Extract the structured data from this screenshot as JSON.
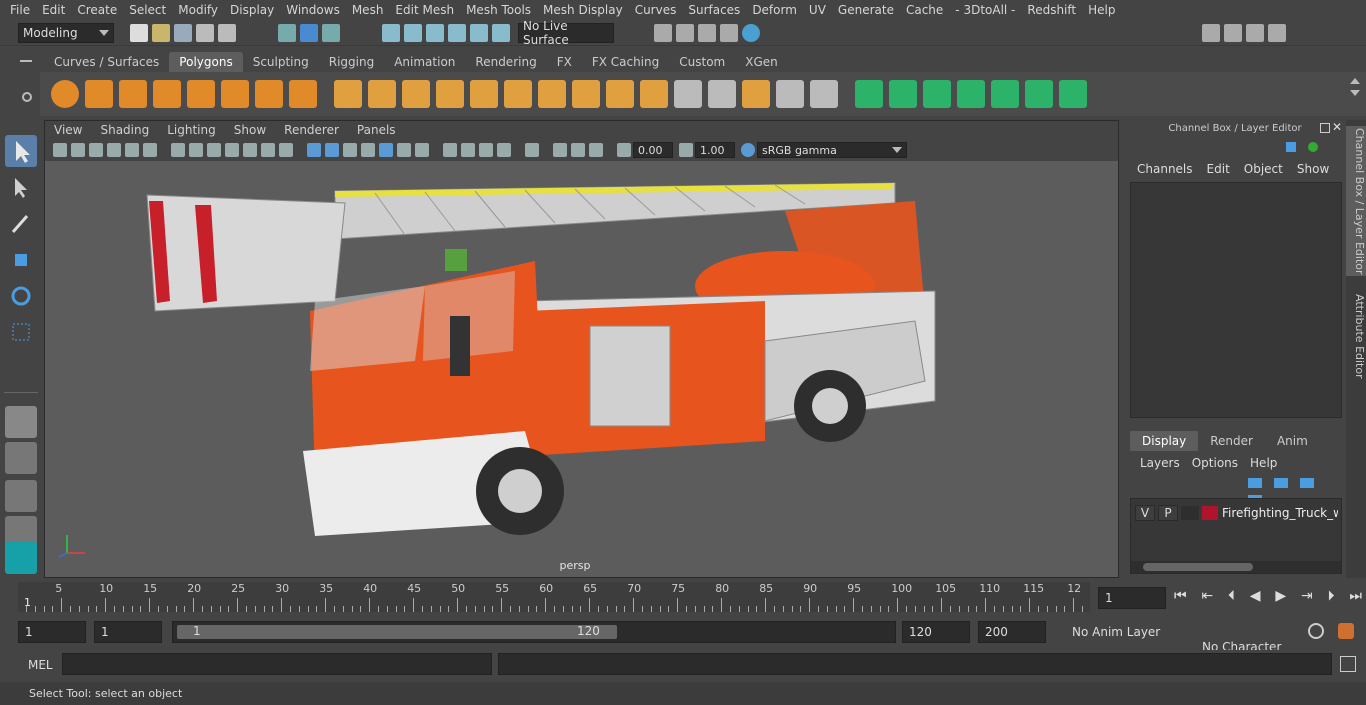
{
  "menu": [
    "File",
    "Edit",
    "Create",
    "Select",
    "Modify",
    "Display",
    "Windows",
    "Mesh",
    "Edit Mesh",
    "Mesh Tools",
    "Mesh Display",
    "Curves",
    "Surfaces",
    "Deform",
    "UV",
    "Generate",
    "Cache",
    "- 3DtoAll -",
    "Redshift",
    "Help"
  ],
  "status": {
    "mode": "Modeling",
    "live_surface": "No Live Surface"
  },
  "shelf_tabs": [
    "Curves / Surfaces",
    "Polygons",
    "Sculpting",
    "Rigging",
    "Animation",
    "Rendering",
    "FX",
    "FX Caching",
    "Custom",
    "XGen"
  ],
  "shelf_active": "Polygons",
  "viewport": {
    "menu": [
      "View",
      "Shading",
      "Lighting",
      "Show",
      "Renderer",
      "Panels"
    ],
    "exposure": "0.00",
    "gamma": "1.00",
    "color_space": "sRGB gamma",
    "camera": "persp"
  },
  "channel_box": {
    "title": "Channel Box / Layer Editor",
    "menu": [
      "Channels",
      "Edit",
      "Object",
      "Show"
    ],
    "layer_tabs": [
      "Display",
      "Render",
      "Anim"
    ],
    "layer_tab_active": "Display",
    "layer_menu": [
      "Layers",
      "Options",
      "Help"
    ],
    "layer": {
      "v": "V",
      "p": "P",
      "name": "Firefighting_Truck_wit",
      "color": "#b0142c"
    }
  },
  "side_tabs": {
    "channel": "Channel Box / Layer Editor",
    "attribute": "Attribute Editor"
  },
  "timeline": {
    "ticks": [
      "5",
      "10",
      "15",
      "20",
      "25",
      "30",
      "35",
      "40",
      "45",
      "50",
      "55",
      "60",
      "65",
      "70",
      "75",
      "80",
      "85",
      "90",
      "95",
      "100",
      "105",
      "110",
      "115",
      "12"
    ],
    "start_label": "1",
    "current_frame": "1"
  },
  "range": {
    "start": "1",
    "playback_start": "1",
    "slider_start": "1",
    "slider_end": "120",
    "end": "120",
    "anim_end": "200",
    "anim_layer": "No Anim Layer",
    "character_set": "No Character Set"
  },
  "cmd": {
    "label": "MEL"
  },
  "help": "Select Tool: select an object"
}
